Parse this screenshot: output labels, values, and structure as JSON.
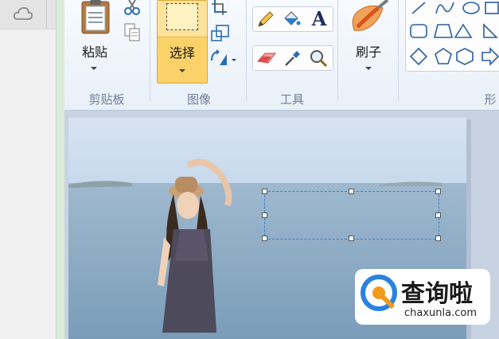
{
  "clipboard": {
    "paste_label": "粘贴",
    "group_label": "剪贴板"
  },
  "image": {
    "select_label": "选择",
    "group_label": "图像"
  },
  "tools": {
    "group_label": "工具",
    "text_tool": "A"
  },
  "brushes": {
    "label": "刷子"
  },
  "shapes": {
    "group_label_partial": "形"
  },
  "watermark": {
    "title": "查询啦",
    "domain": "chaxunla.com"
  },
  "colors": {
    "select_active": "#fbd26a",
    "ribbon_bg": "#eef3fa",
    "canvas_bg": "#c8d3e2"
  }
}
